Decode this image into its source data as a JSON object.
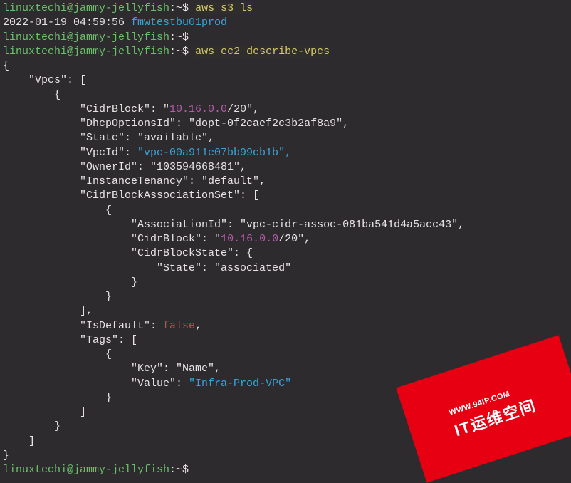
{
  "lines": {
    "l1_userhost": "linuxtechi@jammy-jellyfish",
    "l1_path": ":~$ ",
    "l1_cmd": "aws s3 ls",
    "l2_ts": "2022-01-19 04:59:56 ",
    "l2_name": "fmwtestbu01prod",
    "l3_userhost": "linuxtechi@jammy-jellyfish",
    "l3_path": ":~$",
    "l4_userhost": "linuxtechi@jammy-jellyfish",
    "l4_path": ":~$ ",
    "l4_cmd": "aws ec2 describe-vpcs",
    "last_userhost": "linuxtechi@jammy-jellyfish",
    "last_path": ":~$ "
  },
  "json_out": {
    "brace_open": "{",
    "vpcs_key": "    \"Vpcs\": [",
    "arr_open": "        {",
    "cidr_key": "            \"CidrBlock\": \"",
    "cidr_ip": "10.16.0.0",
    "cidr_suffix": "/20\",",
    "dhcp": "            \"DhcpOptionsId\": \"dopt-0f2caef2c3b2af8a9\",",
    "state": "            \"State\": \"available\",",
    "vpcid_key": "            \"VpcId\": ",
    "vpcid_val": "\"vpc-00a911e07bb99cb1b\",",
    "owner": "            \"OwnerId\": \"103594668481\",",
    "tenancy": "            \"InstanceTenancy\": \"default\",",
    "cbaset": "            \"CidrBlockAssociationSet\": [",
    "cba_open": "                {",
    "associd": "                    \"AssociationId\": \"vpc-cidr-assoc-081ba541d4a5acc43\",",
    "cba_cidr_key": "                    \"CidrBlock\": \"",
    "cba_cidr_ip": "10.16.0.0",
    "cba_cidr_suffix": "/20\",",
    "cbstate_open": "                    \"CidrBlockState\": {",
    "cbstate_val": "                        \"State\": \"associated\"",
    "cbstate_close": "                    }",
    "cba_close": "                }",
    "cbaset_close": "            ],",
    "isdefault_key": "            \"IsDefault\": ",
    "isdefault_val": "false",
    "isdefault_comma": ",",
    "tags_open": "            \"Tags\": [",
    "tag_open": "                {",
    "tag_key": "                    \"Key\": \"Name\",",
    "tag_val_key": "                    \"Value\": ",
    "tag_val_val": "\"Infra-Prod-VPC\"",
    "tag_close": "                }",
    "tags_close": "            ]",
    "arr_close": "        }",
    "vpcs_close": "    ]",
    "brace_close": "}"
  },
  "watermark": {
    "url": "WWW.94IP.COM",
    "title": "IT运维空间"
  }
}
